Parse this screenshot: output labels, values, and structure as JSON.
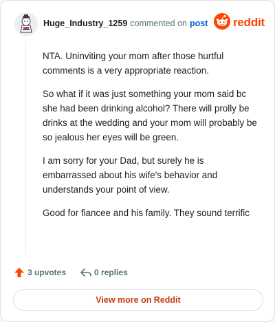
{
  "comment": {
    "username": "Huge_Industry_1259",
    "meta_text": "commented on",
    "post_link_label": "post",
    "paragraphs": [
      "NTA. Uninviting your mom after those hurtful comments is a very appropriate reaction.",
      "So what if it was just something your mom said bc she had been drinking alcohol? There will prolly be drinks at the wedding and your mom will probably be so jealous her eyes will be green.",
      "I am sorry for your Dad, but surely he is embarrassed about his wife's behavior and understands your point of view.",
      "Good for fiancee and his family. They sound terrific"
    ]
  },
  "brand": {
    "logo_text": "reddit",
    "icon": "reddit-snoo-icon",
    "color": "#ff4500"
  },
  "actions": {
    "upvotes_label": "3 upvotes",
    "replies_label": "0 replies",
    "upvote_icon": "upvote-arrow-icon",
    "reply_icon": "reply-arrow-icon"
  },
  "footer": {
    "view_more_label": "View more on Reddit"
  },
  "colors": {
    "accent": "#ff4500",
    "link": "#0a5ad2",
    "view_more_text": "#c63a12",
    "meta": "#576f76"
  }
}
